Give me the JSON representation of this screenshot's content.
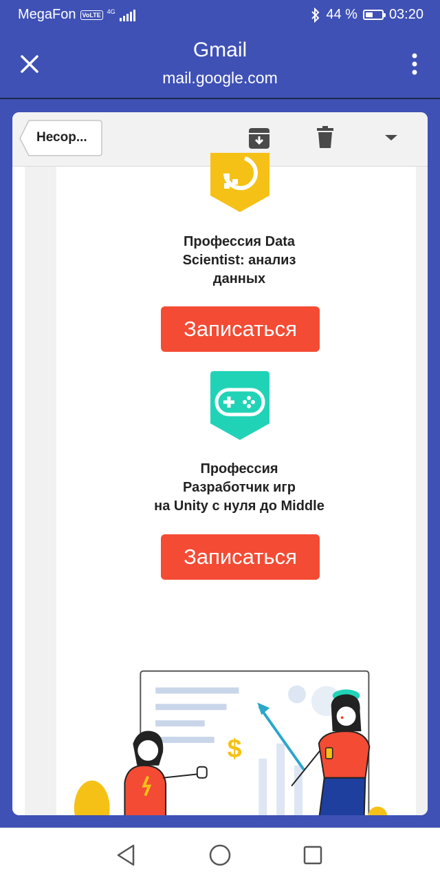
{
  "status": {
    "carrier": "MegaFon",
    "volte": "VoLTE",
    "network": "4G",
    "battery_percent": "44 %",
    "battery_level": 0.44,
    "time": "03:20"
  },
  "appbar": {
    "title": "Gmail",
    "subtitle": "mail.google.com"
  },
  "toolbar": {
    "back_label": "Несор..."
  },
  "courses": [
    {
      "title_lines": [
        "Профессия Data",
        "Scientist: анализ",
        "данных"
      ],
      "button": "Записаться",
      "icon": "data-science-icon",
      "color": "#f5c116"
    },
    {
      "title_lines": [
        "Профессия",
        "Разработчик игр",
        "на Unity с нуля до Middle"
      ],
      "button": "Записаться",
      "icon": "gamepad-icon",
      "color": "#21d3b6"
    }
  ],
  "colors": {
    "appbar": "#3f51b5",
    "cta": "#f44b34",
    "illustration_accent": "#f5c116"
  }
}
